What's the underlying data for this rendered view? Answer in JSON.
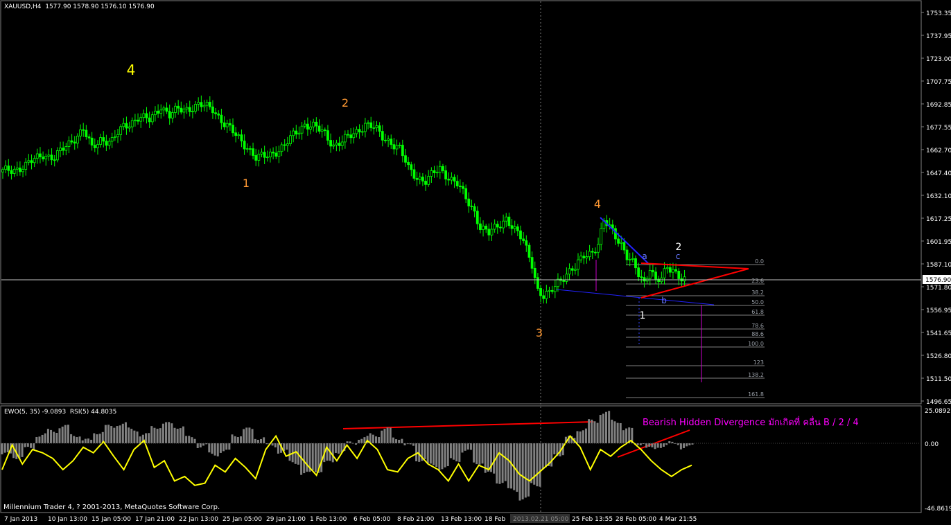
{
  "symbol_header": "XAUUSD,H4  1577.90 1578.90 1576.10 1576.90",
  "indicator_header": "EWO(5, 35) -9.0893  RSI(5) 44.8035",
  "footer": "Millennium Trader 4, ? 2001-2013, MetaQuotes Software Corp.",
  "current_price_label": "1576.90",
  "x_axis_labels": [
    "7 Jan 2013",
    "10 Jan 13:00",
    "15 Jan 05:00",
    "17 Jan 21:00",
    "22 Jan 13:00",
    "25 Jan 05:00",
    "29 Jan 21:00",
    "1 Feb 13:00",
    "6 Feb 05:00",
    "8 Feb 21:00",
    "13 Feb 13:00",
    "18 Feb",
    "2013.02.21 05:00",
    "25 Feb 13:55",
    "28 Feb 05:00",
    "4 Mar 21:55"
  ],
  "price_axis_labels": [
    "1753.35",
    "1737.95",
    "1723.00",
    "1707.75",
    "1692.85",
    "1677.55",
    "1662.70",
    "1647.40",
    "1632.10",
    "1617.25",
    "1601.95",
    "1587.10",
    "1571.80",
    "1556.95",
    "1541.65",
    "1526.80",
    "1511.50",
    "1496.65"
  ],
  "indicator_axis_labels": [
    "25.0892",
    "0.00",
    "-46.8619"
  ],
  "wave_labels": [
    {
      "text": "4",
      "color": "#ffff00"
    },
    {
      "text": "2",
      "color": "#ff9933"
    },
    {
      "text": "1",
      "color": "#ff9933"
    },
    {
      "text": "3",
      "color": "#ff9933"
    },
    {
      "text": "4",
      "color": "#ff9933"
    },
    {
      "text": "a",
      "color": "#6677ff"
    },
    {
      "text": "b",
      "color": "#6677ff"
    },
    {
      "text": "c",
      "color": "#6677ff"
    },
    {
      "text": "2",
      "color": "#ffffff"
    },
    {
      "text": "1",
      "color": "#ffffff"
    }
  ],
  "fib_levels": [
    "0.0",
    "23.6",
    "38.2",
    "50.0",
    "61.8",
    "78.6",
    "88.6",
    "100.0",
    "123",
    "138.2",
    "161.8"
  ],
  "divergence_note": "Bearish Hidden Divergence มักเกิดที่ คลื่น B / 2 / 4",
  "colors": {
    "background": "#000000",
    "bull_candle": "#00ff00",
    "bear_candle": "#00ff00",
    "rsi_line": "#ffff00",
    "ewo_histogram": "#808080",
    "trend_line_red": "#ff0000",
    "trend_line_blue": "#2222ff",
    "fib_line": "#808080",
    "fib_text": "#9aa0a8",
    "axis_text": "#ffffff",
    "note": "#ff00ff"
  },
  "chart_data": [
    {
      "type": "candlestick",
      "title": "XAUUSD,H4",
      "ylim": [
        1496.65,
        1760
      ],
      "close_path": [
        [
          0,
          1648
        ],
        [
          8,
          1652
        ],
        [
          14,
          1660
        ],
        [
          18,
          1657
        ],
        [
          24,
          1669
        ],
        [
          28,
          1676
        ],
        [
          31,
          1663
        ],
        [
          34,
          1670
        ],
        [
          38,
          1668
        ],
        [
          42,
          1678
        ],
        [
          47,
          1684
        ],
        [
          51,
          1682
        ],
        [
          55,
          1692
        ],
        [
          58,
          1685
        ],
        [
          61,
          1689
        ],
        [
          64,
          1690
        ],
        [
          68,
          1692
        ],
        [
          73,
          1690
        ],
        [
          77,
          1680
        ],
        [
          81,
          1672
        ],
        [
          85,
          1665
        ],
        [
          88,
          1657
        ],
        [
          91,
          1658
        ],
        [
          95,
          1662
        ],
        [
          98,
          1665
        ],
        [
          101,
          1672
        ],
        [
          105,
          1680
        ],
        [
          108,
          1678
        ],
        [
          112,
          1673
        ],
        [
          115,
          1666
        ],
        [
          118,
          1668
        ],
        [
          122,
          1673
        ],
        [
          126,
          1680
        ],
        [
          129,
          1677
        ],
        [
          132,
          1671
        ],
        [
          135,
          1668
        ],
        [
          138,
          1663
        ],
        [
          141,
          1650
        ],
        [
          144,
          1645
        ],
        [
          147,
          1642
        ],
        [
          150,
          1647
        ],
        [
          152,
          1650
        ],
        [
          155,
          1645
        ],
        [
          158,
          1640
        ],
        [
          161,
          1630
        ],
        [
          164,
          1622
        ],
        [
          166,
          1612
        ],
        [
          169,
          1607
        ],
        [
          172,
          1612
        ],
        [
          175,
          1618
        ],
        [
          178,
          1609
        ],
        [
          181,
          1602
        ],
        [
          184,
          1588
        ],
        [
          186,
          1570
        ],
        [
          188,
          1565
        ],
        [
          190,
          1567
        ],
        [
          193,
          1576
        ],
        [
          196,
          1581
        ],
        [
          199,
          1584
        ],
        [
          202,
          1593
        ],
        [
          205,
          1596
        ],
        [
          207,
          1600
        ],
        [
          209,
          1615
        ],
        [
          212,
          1609
        ],
        [
          215,
          1601
        ],
        [
          217,
          1592
        ],
        [
          219,
          1587
        ],
        [
          221,
          1580
        ],
        [
          223,
          1575
        ],
        [
          225,
          1586
        ],
        [
          227,
          1576
        ],
        [
          229,
          1577
        ],
        [
          231,
          1584
        ],
        [
          233,
          1584
        ],
        [
          235,
          1580
        ],
        [
          237,
          1577
        ]
      ],
      "annotations": {
        "current_price": 1576.9
      }
    },
    {
      "type": "line+bar",
      "ylim": [
        -46.8619,
        25.0892
      ],
      "series": [
        {
          "name": "EWO(5, 35)",
          "type": "histogram",
          "values": [
            -8,
            -10,
            -4,
            6,
            9,
            12,
            6,
            2,
            8,
            12,
            14,
            10,
            6,
            12,
            14,
            12,
            4,
            -2,
            -8,
            -6,
            6,
            10,
            4,
            -2,
            -6,
            -14,
            -22,
            -20,
            -14,
            -6,
            0,
            4,
            6,
            10,
            4,
            -2,
            -12,
            -16,
            -18,
            -12,
            -6,
            -14,
            -22,
            -28,
            -34,
            -40,
            -30,
            -18,
            -8,
            4,
            10,
            16,
            22,
            16,
            10,
            0,
            -4,
            -2,
            0,
            -3,
            -2,
            -6
          ]
        },
        {
          "name": "RSI(5)",
          "type": "line",
          "values": [
            40,
            62,
            45,
            58,
            55,
            50,
            40,
            48,
            60,
            55,
            65,
            52,
            40,
            58,
            66,
            42,
            48,
            30,
            34,
            26,
            28,
            44,
            38,
            50,
            42,
            32,
            58,
            70,
            52,
            56,
            45,
            35,
            60,
            48,
            62,
            50,
            66,
            58,
            40,
            38,
            50,
            55,
            45,
            40,
            30,
            45,
            30,
            44,
            40,
            55,
            48,
            36,
            30,
            38,
            46,
            56,
            70,
            60,
            40,
            58,
            52,
            60,
            66,
            58,
            48,
            40,
            34,
            40,
            44
          ]
        }
      ]
    }
  ]
}
